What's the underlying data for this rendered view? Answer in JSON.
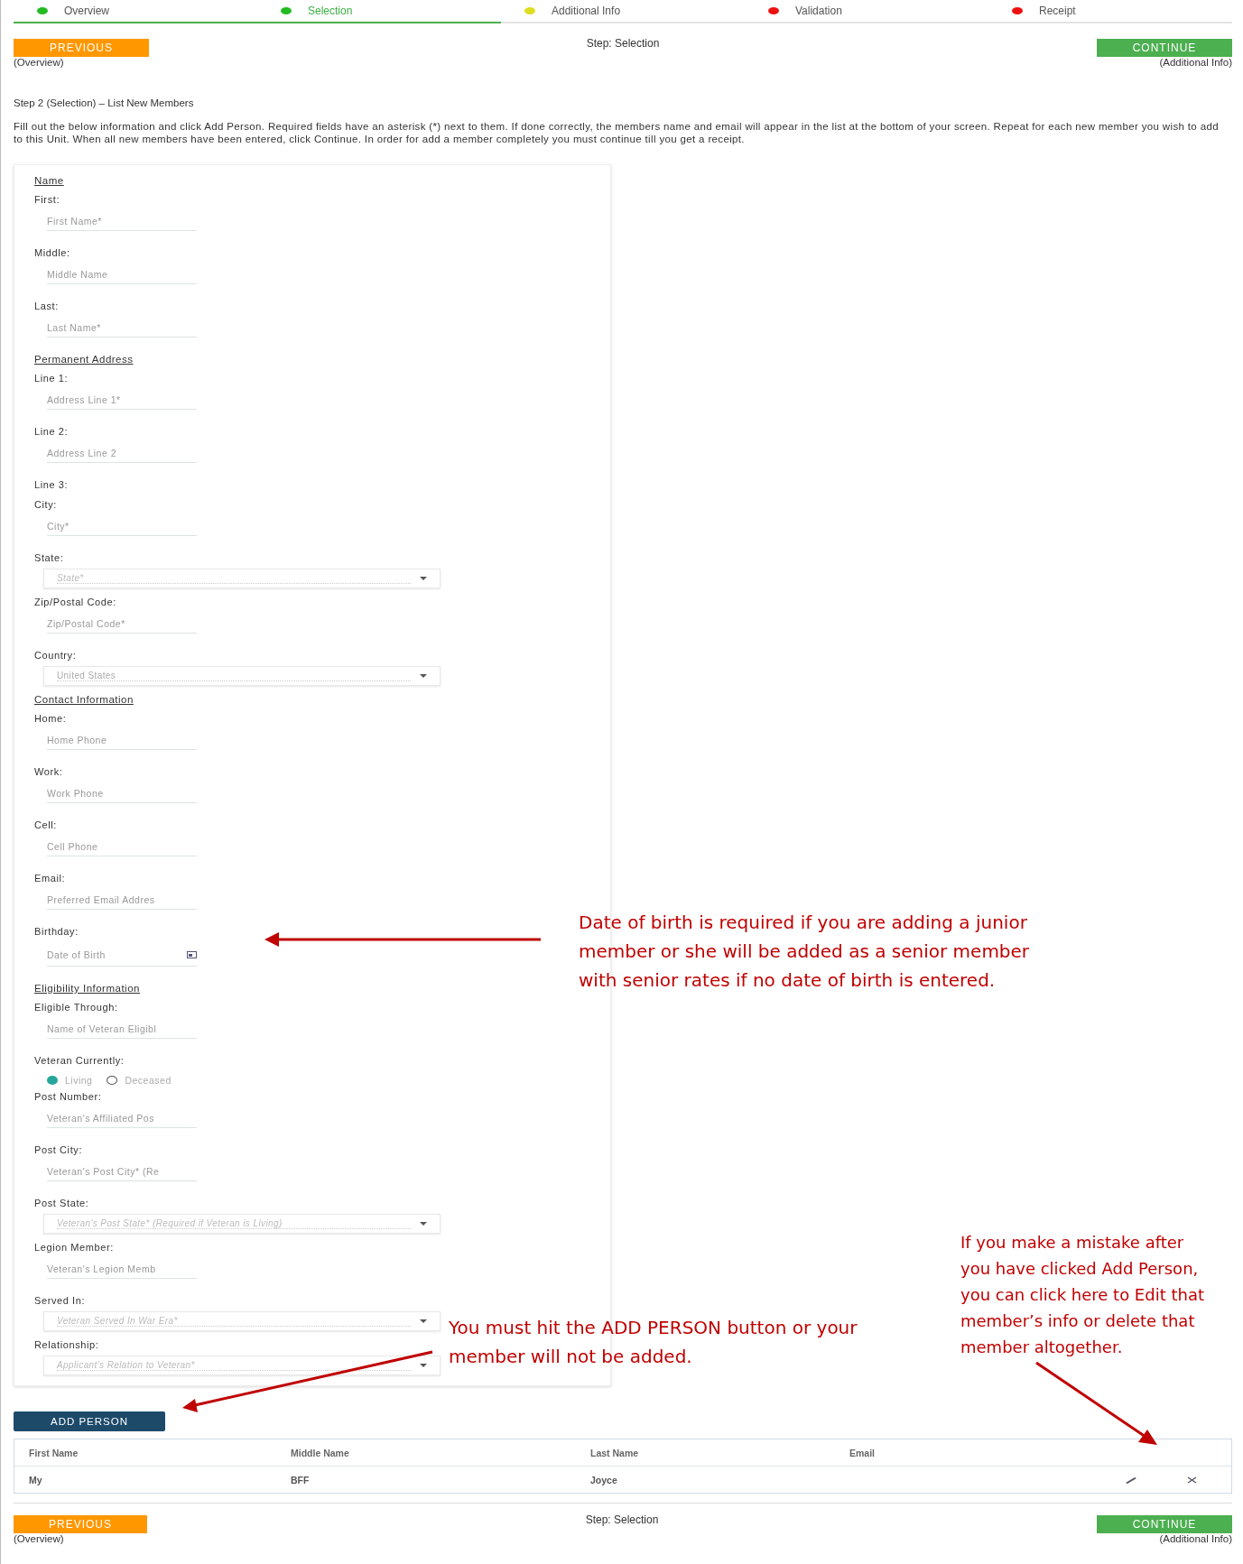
{
  "steps": [
    {
      "label": "Overview",
      "color": "#22bb22",
      "selected": false
    },
    {
      "label": "Selection",
      "color": "#22bb22",
      "selected": true
    },
    {
      "label": "Additional Info",
      "color": "#dddd22",
      "selected": false
    },
    {
      "label": "Validation",
      "color": "#ee1111",
      "selected": false
    },
    {
      "label": "Receipt",
      "color": "#ee1111",
      "selected": false
    }
  ],
  "top_nav": {
    "previous": {
      "label": "PREVIOUS",
      "sub": "(Overview)"
    },
    "step": "Step: Selection",
    "continue": {
      "label": "CONTINUE",
      "sub": "(Additional Info)"
    }
  },
  "heading": "Step 2 (Selection) – List New Members",
  "instructions": "Fill out the below information and click Add Person. Required fields have an asterisk (*) next to them.  If done correctly, the members name and email will appear in the list at the bottom of your screen.  Repeat for each new member you wish to add to this Unit.  When all new members have been entered, click Continue. In order for add a member completely you must continue till you get a receipt.",
  "form": [
    {
      "kind": "heading",
      "label": "Name"
    },
    {
      "kind": "text",
      "label": "First:",
      "placeholder": "First Name*"
    },
    {
      "kind": "text",
      "label": "Middle:",
      "placeholder": "Middle Name"
    },
    {
      "kind": "text",
      "label": "Last:",
      "placeholder": "Last Name*"
    },
    {
      "kind": "heading",
      "label": "Permanent Address"
    },
    {
      "kind": "text",
      "label": "Line 1:",
      "placeholder": "Address Line 1*"
    },
    {
      "kind": "text",
      "label": "Line 2:",
      "placeholder": "Address Line 2"
    },
    {
      "kind": "label",
      "label": "Line 3:"
    },
    {
      "kind": "text",
      "label": "City:",
      "placeholder": "City*"
    },
    {
      "kind": "select",
      "label": "State:",
      "placeholder": "State*"
    },
    {
      "kind": "text",
      "label": "Zip/Postal Code:",
      "placeholder": "Zip/Postal Code*"
    },
    {
      "kind": "select",
      "label": "Country:",
      "value": "United States"
    },
    {
      "kind": "heading",
      "label": "Contact Information"
    },
    {
      "kind": "text",
      "label": "Home:",
      "placeholder": "Home Phone"
    },
    {
      "kind": "text",
      "label": "Work:",
      "placeholder": "Work Phone"
    },
    {
      "kind": "text",
      "label": "Cell:",
      "placeholder": "Cell Phone"
    },
    {
      "kind": "text",
      "label": "Email:",
      "placeholder": "Preferred Email Addres"
    },
    {
      "kind": "date",
      "label": "Birthday:",
      "placeholder": "Date of Birth"
    },
    {
      "kind": "heading",
      "label": "Eligibility Information"
    },
    {
      "kind": "text",
      "label": "Eligible Through:",
      "placeholder": "Name of Veteran Eligibl"
    },
    {
      "kind": "radio",
      "label": "Veteran Currently:",
      "options": [
        {
          "label": "Living",
          "selected": true
        },
        {
          "label": "Deceased",
          "selected": false
        }
      ]
    },
    {
      "kind": "text",
      "label": "Post Number:",
      "placeholder": "Veteran's Affiliated Pos"
    },
    {
      "kind": "text",
      "label": "Post City:",
      "placeholder": "Veteran's Post City* (Re"
    },
    {
      "kind": "select",
      "label": "Post State:",
      "placeholder": "Veteran's Post State* (Required if Veteran is Living)"
    },
    {
      "kind": "text",
      "label": "Legion Member:",
      "placeholder": "Veteran's Legion Memb"
    },
    {
      "kind": "select",
      "label": "Served In:",
      "placeholder": "Veteran Served In War Era*"
    },
    {
      "kind": "select",
      "label": "Relationship:",
      "placeholder": "Applicant's Relation to Veteran*"
    }
  ],
  "add_button": "ADD PERSON",
  "table": {
    "columns": [
      "First Name",
      "Middle Name",
      "Last Name",
      "Email"
    ],
    "rows": [
      {
        "cells": [
          "My",
          "BFF",
          "Joyce"
        ]
      }
    ]
  },
  "bottom_nav": {
    "previous": {
      "label": "PREVIOUS",
      "sub": "(Overview)"
    },
    "step": "Step: Selection",
    "continue": {
      "label": "CONTINUE",
      "sub": "(Additional Info)"
    }
  },
  "annotations": [
    "Date of birth is required if you are adding a junior member or she will be added as a senior member with senior rates if no date of birth is entered.",
    "You must hit the ADD PERSON button or your member will not be added.",
    "If you make a mistake after you have clicked Add Person, you can click here to Edit that member’s info or delete that member altogether."
  ]
}
